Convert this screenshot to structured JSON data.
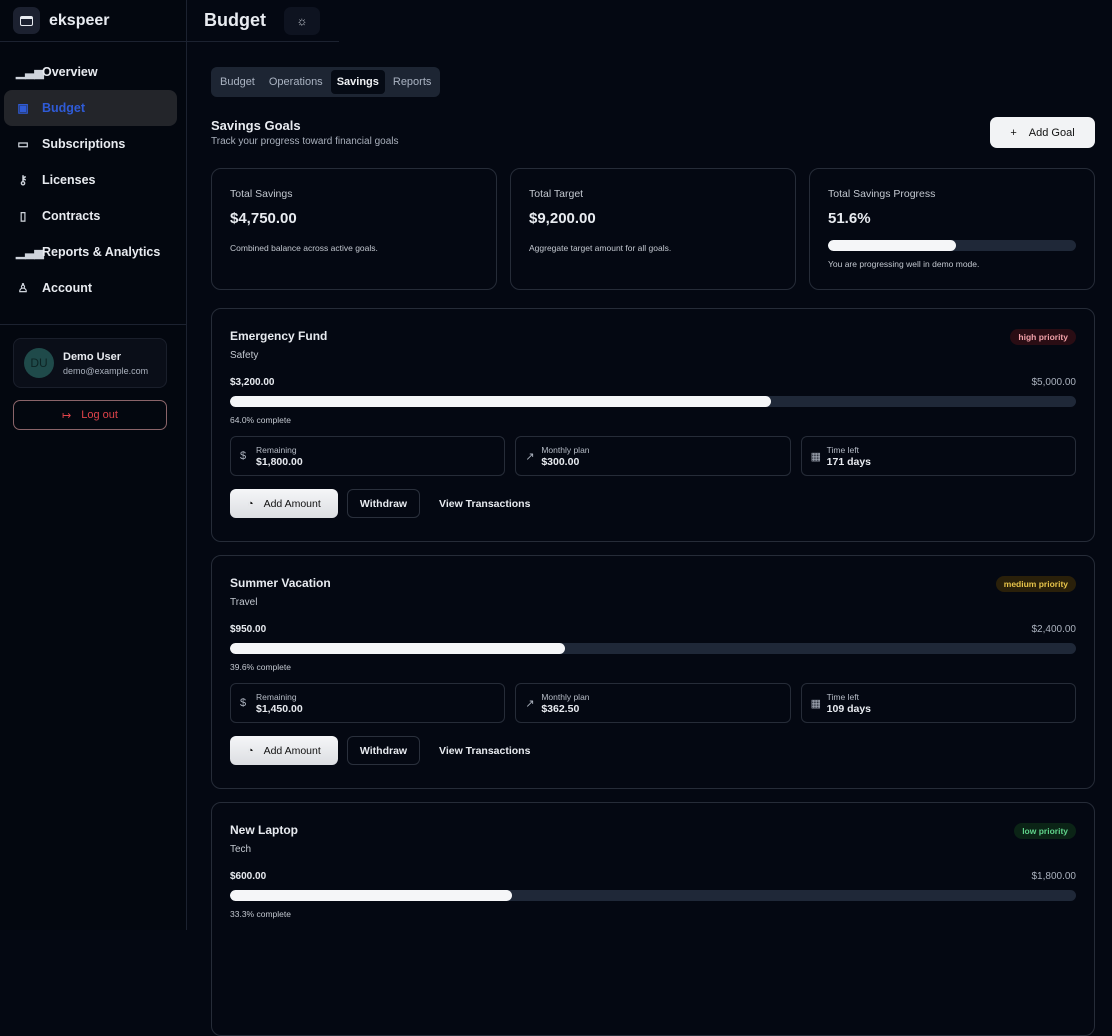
{
  "app": {
    "name": "ekspeer"
  },
  "sidebar": {
    "items": [
      {
        "label": "Overview",
        "icon": "bar-chart"
      },
      {
        "label": "Budget",
        "icon": "wallet"
      },
      {
        "label": "Subscriptions",
        "icon": "credit-card"
      },
      {
        "label": "Licenses",
        "icon": "key"
      },
      {
        "label": "Contracts",
        "icon": "file"
      },
      {
        "label": "Reports & Analytics",
        "icon": "bar-chart"
      },
      {
        "label": "Account",
        "icon": "user"
      }
    ],
    "user": {
      "initials": "DU",
      "name": "Demo User",
      "email": "demo@example.com"
    },
    "logout": "Log out"
  },
  "header": {
    "title": "Budget"
  },
  "tabs": [
    "Budget",
    "Operations",
    "Savings",
    "Reports"
  ],
  "section": {
    "title": "Savings Goals",
    "subtitle": "Track your progress toward financial goals",
    "add_goal": "Add Goal"
  },
  "summary": [
    {
      "label": "Total Savings",
      "value": "$4,750.00",
      "note": "Combined balance across active goals."
    },
    {
      "label": "Total Target",
      "value": "$9,200.00",
      "note": "Aggregate target amount for all goals."
    },
    {
      "label": "Total Savings Progress",
      "value": "51.6%",
      "progress": 51.6,
      "note": "You are progressing well in demo mode."
    }
  ],
  "goals": [
    {
      "title": "Emergency Fund",
      "category": "Safety",
      "priority": "high priority",
      "saved": "$3,200.00",
      "target": "$5,000.00",
      "progress": 64.0,
      "pct_label": "64.0% complete",
      "remaining_label": "Remaining",
      "remaining": "$1,800.00",
      "monthly_label": "Monthly plan",
      "monthly": "$300.00",
      "time_label": "Time left",
      "time": "171 days"
    },
    {
      "title": "Summer Vacation",
      "category": "Travel",
      "priority": "medium priority",
      "saved": "$950.00",
      "target": "$2,400.00",
      "progress": 39.6,
      "pct_label": "39.6% complete",
      "remaining_label": "Remaining",
      "remaining": "$1,450.00",
      "monthly_label": "Monthly plan",
      "monthly": "$362.50",
      "time_label": "Time left",
      "time": "109 days"
    },
    {
      "title": "New Laptop",
      "category": "Tech",
      "priority": "low priority",
      "saved": "$600.00",
      "target": "$1,800.00",
      "progress": 33.3,
      "pct_label": "33.3% complete"
    }
  ],
  "actions": {
    "add": "Add Amount",
    "withdraw": "Withdraw",
    "view": "View Transactions"
  },
  "colors": {
    "accent": "#2f5bd6",
    "high": "#f0a0a8",
    "medium": "#e8c44a",
    "low": "#5fd38a"
  }
}
